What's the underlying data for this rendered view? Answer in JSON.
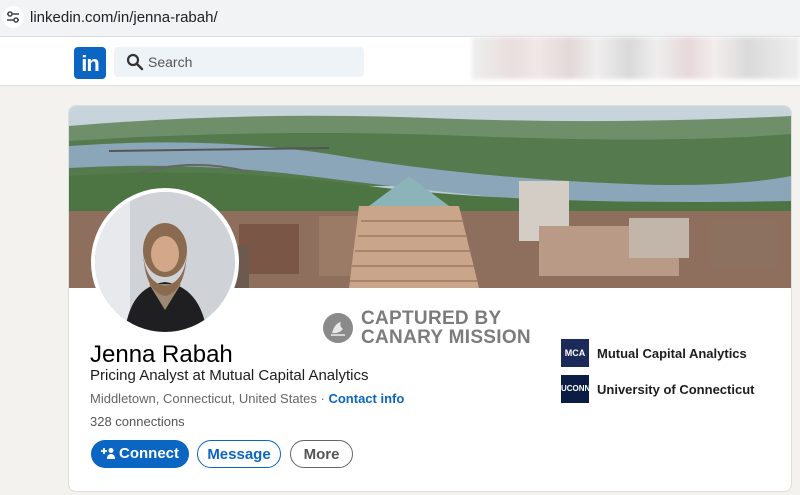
{
  "browser": {
    "url": "linkedin.com/in/jenna-rabah/"
  },
  "nav": {
    "logo_text": "in",
    "search_placeholder": "Search"
  },
  "profile": {
    "name": "Jenna Rabah",
    "headline": "Pricing Analyst at Mutual Capital Analytics",
    "location": "Middletown, Connecticut, United States",
    "separator": " · ",
    "contact_info_label": "Contact info",
    "connections": "328 connections"
  },
  "watermark": {
    "line1": "CAPTURED BY",
    "line2": "CANARY MISSION"
  },
  "actions": {
    "connect_label": "Connect",
    "message_label": "Message",
    "more_label": "More"
  },
  "organizations": [
    {
      "logo_text": "MCA",
      "name": "Mutual Capital Analytics",
      "logo_color": "#1c2a5a"
    },
    {
      "logo_text": "UCONN",
      "name": "University of Connecticut",
      "logo_color": "#0b1d44"
    }
  ],
  "colors": {
    "linkedin_blue": "#0a66c2",
    "page_bg": "#f4f2ee"
  },
  "icons": [
    "tune-icon",
    "linkedin-logo",
    "search-icon",
    "add-person-icon",
    "canary-mission-logo"
  ]
}
